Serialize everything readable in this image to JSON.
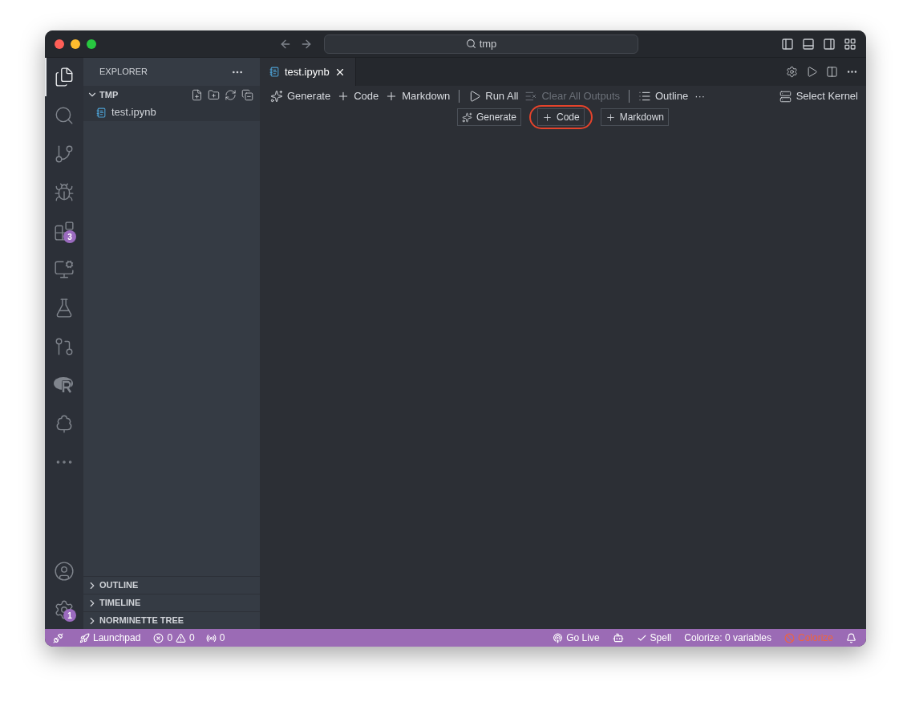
{
  "window": {
    "title": "tmp"
  },
  "activity_bar": {
    "items": [
      {
        "kind": "explorer",
        "selected": true
      },
      {
        "kind": "search",
        "selected": false
      },
      {
        "kind": "source-control",
        "selected": false
      },
      {
        "kind": "run-debug",
        "selected": false
      },
      {
        "kind": "extensions",
        "selected": false,
        "badge": "3"
      },
      {
        "kind": "remote",
        "selected": false
      },
      {
        "kind": "testing",
        "selected": false
      },
      {
        "kind": "git-graph",
        "selected": false
      },
      {
        "kind": "r",
        "selected": false
      },
      {
        "kind": "tree",
        "selected": false
      },
      {
        "kind": "more",
        "selected": false
      }
    ],
    "bottom_items": [
      {
        "kind": "accounts"
      },
      {
        "kind": "manage",
        "badge": "1"
      }
    ]
  },
  "sidebar": {
    "title": "EXPLORER",
    "folder": {
      "label": "TMP",
      "expanded": true,
      "files": [
        {
          "name": "test.ipynb"
        }
      ]
    },
    "sections": [
      {
        "label": "OUTLINE",
        "expanded": false
      },
      {
        "label": "TIMELINE",
        "expanded": false
      },
      {
        "label": "NORMINETTE TREE",
        "expanded": false
      }
    ]
  },
  "editor": {
    "tabs": [
      {
        "label": "test.ipynb",
        "selected": true
      }
    ],
    "toolbar": [
      {
        "kind": "generate",
        "label": "Generate",
        "disabled": false
      },
      {
        "kind": "add",
        "label": "Code",
        "disabled": false
      },
      {
        "kind": "add",
        "label": "Markdown",
        "disabled": false
      },
      {
        "kind": "separator"
      },
      {
        "kind": "run",
        "label": "Run All",
        "disabled": false
      },
      {
        "kind": "clear",
        "label": "Clear All Outputs",
        "disabled": true
      },
      {
        "kind": "separator"
      },
      {
        "kind": "outline",
        "label": "Outline",
        "disabled": false
      },
      {
        "kind": "more",
        "label": "···",
        "disabled": false
      }
    ],
    "kernel": "Select Kernel",
    "cell_buttons": [
      {
        "kind": "generate",
        "label": "Generate",
        "highlighted": false
      },
      {
        "kind": "add",
        "label": "Code",
        "highlighted": true
      },
      {
        "kind": "add",
        "label": "Markdown",
        "highlighted": false
      }
    ]
  },
  "status_bar": {
    "left": [
      {
        "kind": "remote"
      },
      {
        "kind": "launchpad",
        "label": "Launchpad"
      },
      {
        "kind": "problems",
        "errors": "0",
        "warnings": "0"
      },
      {
        "kind": "ports",
        "label": "0"
      }
    ],
    "right": [
      {
        "kind": "go-live",
        "label": "Go Live",
        "disabled": false
      },
      {
        "kind": "copilot",
        "disabled": false
      },
      {
        "kind": "spell",
        "label": "Spell",
        "disabled": false
      },
      {
        "kind": "text",
        "label": "Colorize: 0 variables",
        "disabled": false
      },
      {
        "kind": "colorize",
        "label": "Colorize",
        "disabled": true
      },
      {
        "kind": "bell",
        "disabled": false
      }
    ]
  }
}
